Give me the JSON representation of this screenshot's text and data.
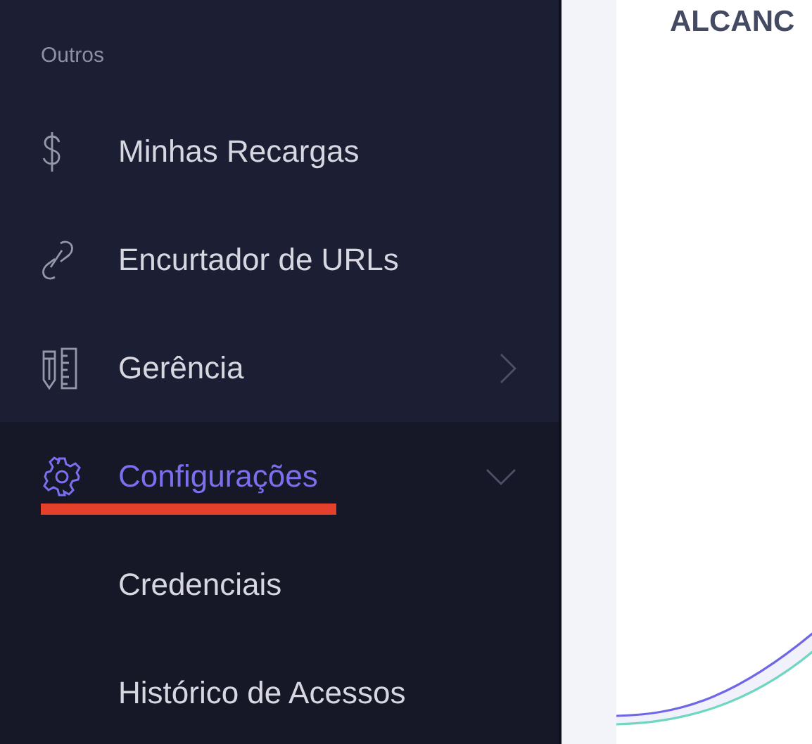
{
  "sidebar": {
    "section_label": "Outros",
    "items": [
      {
        "label": "Minhas Recargas",
        "kind": "dollar",
        "selected": false
      },
      {
        "label": "Encurtador de URLs",
        "kind": "link",
        "selected": false
      },
      {
        "label": "Gerência",
        "kind": "tools",
        "selected": false,
        "expanded": false
      },
      {
        "label": "Configurações",
        "kind": "gear",
        "selected": true,
        "expanded": true,
        "underlined": true,
        "children": [
          {
            "label": "Credenciais"
          },
          {
            "label": "Histórico de Acessos"
          }
        ]
      }
    ]
  },
  "main": {
    "card_title": "ALCANC"
  }
}
